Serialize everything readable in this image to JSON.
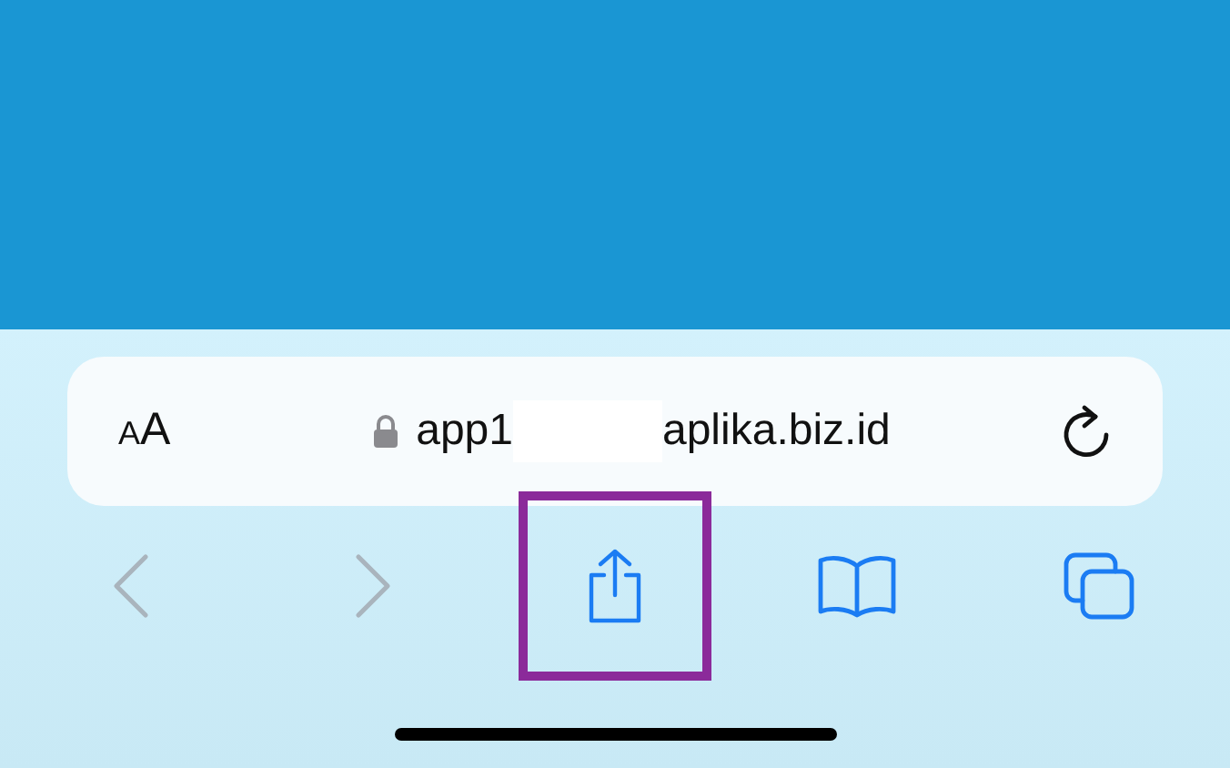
{
  "address_bar": {
    "text_size_button": {
      "small": "A",
      "large": "A"
    },
    "secure": true,
    "url_start": "app1",
    "url_redacted": true,
    "url_end": "aplika.biz.id"
  },
  "toolbar": [
    {
      "kind": "back",
      "disabled": true,
      "highlighted": false
    },
    {
      "kind": "forward",
      "disabled": true,
      "highlighted": false
    },
    {
      "kind": "share",
      "disabled": false,
      "highlighted": true
    },
    {
      "kind": "bookmarks",
      "disabled": false,
      "highlighted": false
    },
    {
      "kind": "tabs",
      "disabled": false,
      "highlighted": false
    }
  ]
}
